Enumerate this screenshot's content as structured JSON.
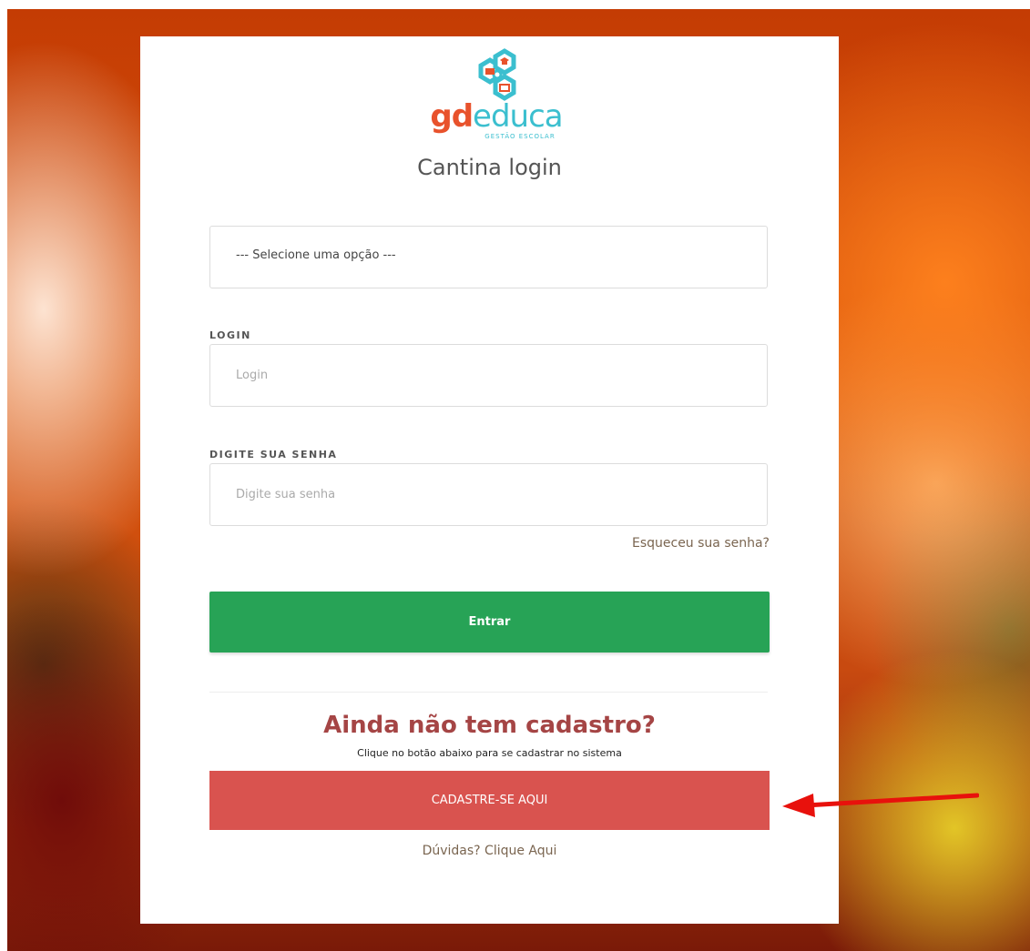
{
  "brand": {
    "logo_gd": "gd",
    "logo_educa": "educa",
    "logo_subtitle": "GESTÃO ESCOLAR"
  },
  "page": {
    "title": "Cantina login"
  },
  "form": {
    "select_value": "--- Selecione uma opção ---",
    "login_label": "LOGIN",
    "login_placeholder": "Login",
    "password_label": "DIGITE SUA SENHA",
    "password_placeholder": "Digite sua senha",
    "forgot_link": "Esqueceu sua senha?",
    "submit_label": "Entrar"
  },
  "signup": {
    "title": "Ainda não tem cadastro?",
    "subtitle": "Clique no botão abaixo para se cadastrar no sistema",
    "button_label": "CADASTRE-SE AQUI",
    "help_link": "Dúvidas? Clique Aqui"
  },
  "colors": {
    "primary_green": "#27a356",
    "signup_red": "#d9534f",
    "heading_red": "#a54545",
    "logo_orange": "#e8522c",
    "logo_cyan": "#3bbfcf",
    "annotation_arrow": "#e8110c"
  },
  "icons": {
    "logo_mark": "hexagon-education-icon",
    "annotation": "red-arrow-left-icon"
  }
}
